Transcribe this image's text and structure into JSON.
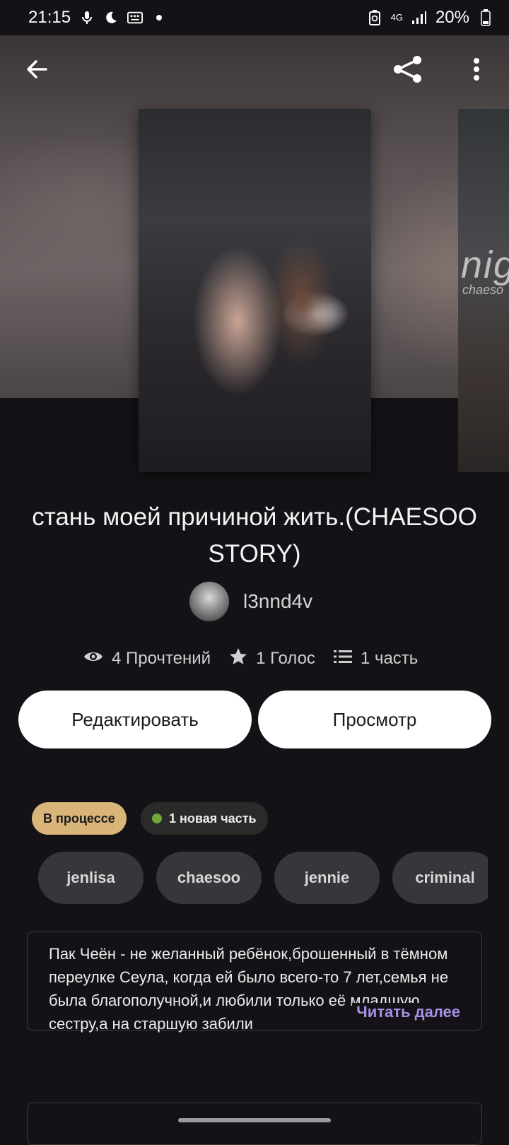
{
  "status_bar": {
    "time": "21:15",
    "network": "4G",
    "battery": "20%"
  },
  "story": {
    "title": "стань моей причиной жить.(CHAESOO STORY)",
    "author": "l3nnd4v",
    "side_cover_text": "nig",
    "side_cover_sub": "chaeso"
  },
  "stats": {
    "reads": "4 Прочтений",
    "votes": "1 Голос",
    "parts": "1 часть"
  },
  "buttons": {
    "edit": "Редактировать",
    "preview": "Просмотр"
  },
  "chips": {
    "status": "В процессе",
    "new_part": "1 новая часть"
  },
  "tags": [
    "jenlisa",
    "chaesoo",
    "jennie",
    "criminal"
  ],
  "description": {
    "text": "Пак Чеён - не желанный ребёнок,брошенный в тёмном переулке Сеула, когда ей было всего-то 7 лет,семья не была благополучной,и любили только её младшую сестру,а на старшую забили",
    "read_more": "Читать далее"
  },
  "colors": {
    "background": "#141216",
    "status_chip": "#d9b57a",
    "accent_read_more": "#a98fe6",
    "new_dot": "#6fa83a"
  },
  "icons": [
    "back-arrow-icon",
    "share-icon",
    "more-vert-icon",
    "eye-icon",
    "star-icon",
    "list-icon"
  ]
}
